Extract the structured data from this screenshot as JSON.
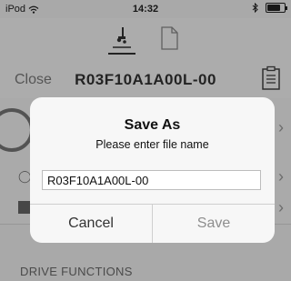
{
  "status_bar": {
    "carrier": "iPod",
    "time": "14:32"
  },
  "nav": {
    "close_label": "Close",
    "title": "R03F10A1A00L-00"
  },
  "background": {
    "section_label": "DRIVE FUNCTIONS"
  },
  "dialog": {
    "title": "Save As",
    "message": "Please enter file name",
    "filename_value": "R03F10A1A00L-00",
    "cancel_label": "Cancel",
    "save_label": "Save"
  },
  "icons": {
    "wifi": "wifi-icon",
    "bluetooth": "bluetooth-icon",
    "battery": "battery-icon",
    "chair": "wheelchair-mode-icon",
    "document": "document-mode-icon",
    "doc_button": "document-list-icon"
  },
  "colors": {
    "accent": "#333333",
    "disabled_button": "#8e8e8e"
  }
}
